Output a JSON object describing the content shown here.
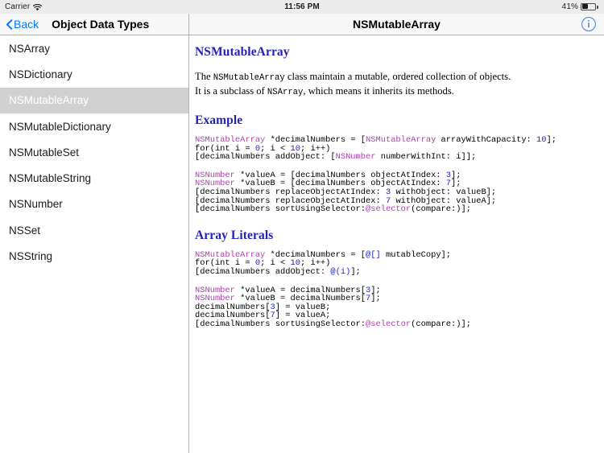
{
  "status_bar": {
    "carrier": "Carrier",
    "wifi_icon": "wifi-icon",
    "time": "11:56 PM",
    "battery_percent": "41%",
    "battery_icon": "battery-icon"
  },
  "master_nav": {
    "back_icon": "chevron-left-icon",
    "back_label": "Back",
    "title": "Object Data Types"
  },
  "detail_nav": {
    "title": "NSMutableArray",
    "info_icon": "info-circle-icon"
  },
  "sidebar": {
    "items": [
      {
        "label": "NSArray",
        "selected": false
      },
      {
        "label": "NSDictionary",
        "selected": false
      },
      {
        "label": "NSMutableArray",
        "selected": true
      },
      {
        "label": "NSMutableDictionary",
        "selected": false
      },
      {
        "label": "NSMutableSet",
        "selected": false
      },
      {
        "label": "NSMutableString",
        "selected": false
      },
      {
        "label": "NSNumber",
        "selected": false
      },
      {
        "label": "NSSet",
        "selected": false
      },
      {
        "label": "NSString",
        "selected": false
      }
    ]
  },
  "document": {
    "heading": "NSMutableArray",
    "intro_line_1_pre": "The ",
    "intro_line_1_code": "NSMutableArray",
    "intro_line_1_post": " class maintain a mutable, ordered collection of objects.",
    "intro_line_2_pre": "It is a subclass of ",
    "intro_line_2_code": "NSArray",
    "intro_line_2_post": ", which means it inherits its methods.",
    "sections": [
      {
        "heading": "Example",
        "blocks": [
          [
            [
              {
                "t": "NSMutableArray",
                "c": "cls"
              },
              {
                "t": " *decimalNumbers = [",
                "c": ""
              },
              {
                "t": "NSMutableArray",
                "c": "cls"
              },
              {
                "t": " arrayWithCapacity: ",
                "c": ""
              },
              {
                "t": "10",
                "c": "num"
              },
              {
                "t": "];",
                "c": ""
              }
            ],
            [
              {
                "t": "for(int i = ",
                "c": ""
              },
              {
                "t": "0",
                "c": "num"
              },
              {
                "t": "; i < ",
                "c": ""
              },
              {
                "t": "10",
                "c": "num"
              },
              {
                "t": "; i++)",
                "c": ""
              }
            ],
            [
              {
                "t": "[decimalNumbers addObject: [",
                "c": ""
              },
              {
                "t": "NSNumber",
                "c": "cls"
              },
              {
                "t": " numberWithInt: i]];",
                "c": ""
              }
            ]
          ],
          [
            [
              {
                "t": "NSNumber",
                "c": "cls"
              },
              {
                "t": " *valueA = [decimalNumbers objectAtIndex: ",
                "c": ""
              },
              {
                "t": "3",
                "c": "num"
              },
              {
                "t": "];",
                "c": ""
              }
            ],
            [
              {
                "t": "NSNumber",
                "c": "cls"
              },
              {
                "t": " *valueB = [decimalNumbers objectAtIndex: ",
                "c": ""
              },
              {
                "t": "7",
                "c": "num"
              },
              {
                "t": "];",
                "c": ""
              }
            ],
            [
              {
                "t": "[decimalNumbers replaceObjectAtIndex: ",
                "c": ""
              },
              {
                "t": "3",
                "c": "num"
              },
              {
                "t": " withObject: valueB];",
                "c": ""
              }
            ],
            [
              {
                "t": "[decimalNumbers replaceObjectAtIndex: ",
                "c": ""
              },
              {
                "t": "7",
                "c": "num"
              },
              {
                "t": " withObject: valueA];",
                "c": ""
              }
            ],
            [
              {
                "t": "[decimalNumbers sortUsingSelector:",
                "c": ""
              },
              {
                "t": "@selector",
                "c": "sel"
              },
              {
                "t": "(compare:)];",
                "c": ""
              }
            ]
          ]
        ]
      },
      {
        "heading": "Array Literals",
        "blocks": [
          [
            [
              {
                "t": "NSMutableArray",
                "c": "cls"
              },
              {
                "t": " *decimalNumbers = [",
                "c": ""
              },
              {
                "t": "@[]",
                "c": "lit"
              },
              {
                "t": " mutableCopy];",
                "c": ""
              }
            ],
            [
              {
                "t": "for(int i = ",
                "c": ""
              },
              {
                "t": "0",
                "c": "num"
              },
              {
                "t": "; i < ",
                "c": ""
              },
              {
                "t": "10",
                "c": "num"
              },
              {
                "t": "; i++)",
                "c": ""
              }
            ],
            [
              {
                "t": "[decimalNumbers addObject: ",
                "c": ""
              },
              {
                "t": "@(i)",
                "c": "lit"
              },
              {
                "t": "];",
                "c": ""
              }
            ]
          ],
          [
            [
              {
                "t": "NSNumber",
                "c": "cls"
              },
              {
                "t": " *valueA = decimalNumbers[",
                "c": ""
              },
              {
                "t": "3",
                "c": "num"
              },
              {
                "t": "];",
                "c": ""
              }
            ],
            [
              {
                "t": "NSNumber",
                "c": "cls"
              },
              {
                "t": " *valueB = decimalNumbers[",
                "c": ""
              },
              {
                "t": "7",
                "c": "num"
              },
              {
                "t": "];",
                "c": ""
              }
            ],
            [
              {
                "t": "decimalNumbers[",
                "c": ""
              },
              {
                "t": "3",
                "c": "num"
              },
              {
                "t": "] = valueB;",
                "c": ""
              }
            ],
            [
              {
                "t": "decimalNumbers[",
                "c": ""
              },
              {
                "t": "7",
                "c": "num"
              },
              {
                "t": "] = valueA;",
                "c": ""
              }
            ],
            [
              {
                "t": "[decimalNumbers sortUsingSelector:",
                "c": ""
              },
              {
                "t": "@selector",
                "c": "sel"
              },
              {
                "t": "(compare:)];",
                "c": ""
              }
            ]
          ]
        ]
      }
    ]
  },
  "colors": {
    "accent_blue": "#007aff",
    "heading_blue": "#2222bb",
    "code_class_purple": "#b040b0",
    "code_number_blue": "#2222cc",
    "selected_row_gray": "#d1d1d1",
    "chrome_gray": "#f7f7f7"
  }
}
